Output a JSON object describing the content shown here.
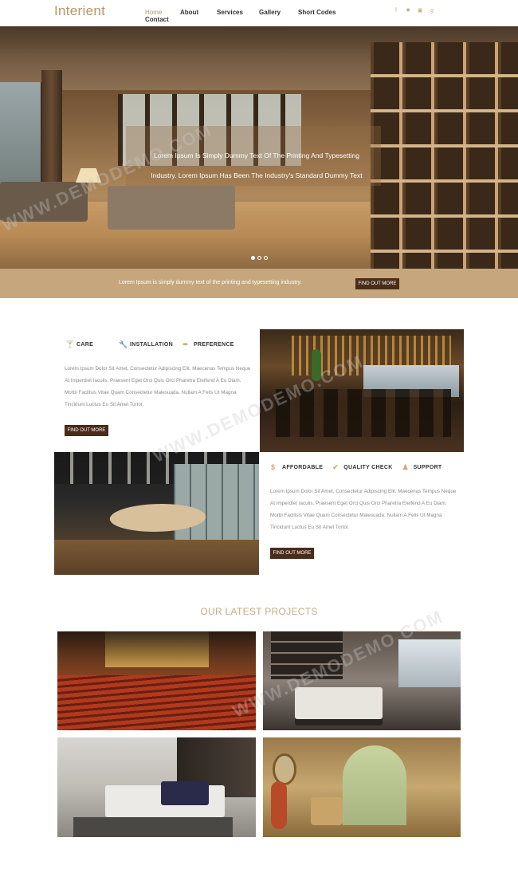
{
  "brand": {
    "logo": "Interient"
  },
  "nav": {
    "items": [
      {
        "label": "Home"
      },
      {
        "label": "About"
      },
      {
        "label": "Services"
      },
      {
        "label": "Gallery"
      },
      {
        "label": "Short Codes"
      },
      {
        "label": "Contact"
      }
    ],
    "active": "Home"
  },
  "social": [
    "facebook-icon",
    "twitter-icon",
    "instagram-icon",
    "google-plus-icon"
  ],
  "hero": {
    "caption_line1": "Lorem Ipsum Is Simply Dummy Text Of The Printing And Typesetting",
    "caption_line2": "Industry. Lorem Ipsum Has Been The Industry's Standard Dummy Text",
    "slide_count": 3,
    "active_slide": 1
  },
  "banner": {
    "text": "Lorem Ipsum is simply dummy text of the printing and typesetting industry.",
    "button": "FIND OUT MORE"
  },
  "feature_block_1": {
    "items": [
      {
        "label": "CARE",
        "icon": "cocktail-icon"
      },
      {
        "label": "INSTALLATION",
        "icon": "wrench-icon"
      },
      {
        "label": "PREFERENCE",
        "icon": "brush-icon"
      }
    ],
    "text": "Lorem Ipsum Dolor Sit Amet, Consectetur Adipiscing Elit. Maecenas Tempus Neque At Imperdiet Iaculis. Praesent Eget Orci Quis Orci Pharetra Eleifend A Eu Diam. Morbi Facilisis Vitae Quam Consectetur Malesuada. Nullam A Felis Ut Magna Tincidunt Luctus Eu Sit Amet Tortor.",
    "button": "FIND OUT MORE"
  },
  "feature_block_2": {
    "items": [
      {
        "label": "AFFORDABLE",
        "icon": "dollar-icon"
      },
      {
        "label": "QUALITY CHECK",
        "icon": "check-icon"
      },
      {
        "label": "SUPPORT",
        "icon": "user-icon"
      }
    ],
    "text": "Lorem Ipsum Dolor Sit Amet, Consectetur Adipiscing Elit. Maecenas Tempus Neque At Imperdiet Iaculis. Praesent Eget Orci Quis Orci Pharetra Eleifend A Eu Diam. Morbi Facilisis Vitae Quam Consectetur Malesuada. Nullam A Felis Ut Magna Tincidunt Luctus Eu Sit Amet Tortor.",
    "button": "FIND OUT MORE"
  },
  "projects": {
    "title": "OUR LATEST PROJECTS"
  },
  "watermark": "WWW.DEMODEMO.COM",
  "colors": {
    "accent": "#c8ab85",
    "button_dark": "#4a2c1a",
    "banner_bg": "#c6a67d"
  }
}
